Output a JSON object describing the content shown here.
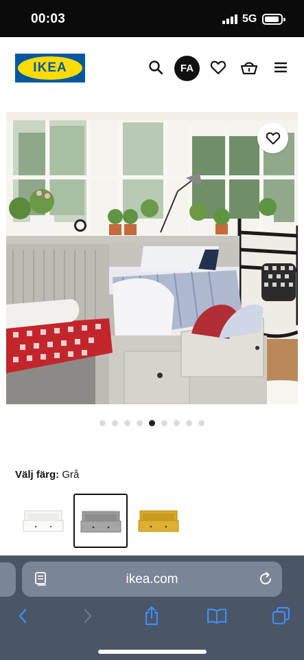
{
  "status": {
    "time": "00:03",
    "network": "5G"
  },
  "header": {
    "logo_text": "IKEA",
    "avatar_initials": "FA",
    "icons": [
      "search-icon",
      "heart-icon",
      "basket-icon",
      "menu-icon"
    ]
  },
  "gallery": {
    "image_count": 9,
    "active_index": 4
  },
  "color_picker": {
    "label": "Välj färg:",
    "selected_value": "Grå",
    "swatches": [
      "white",
      "grey",
      "yellow"
    ],
    "selected_index": 1
  },
  "browser": {
    "url": "ikea.com",
    "accent": "#0058a3",
    "brand_yellow": "#ffdb00"
  }
}
